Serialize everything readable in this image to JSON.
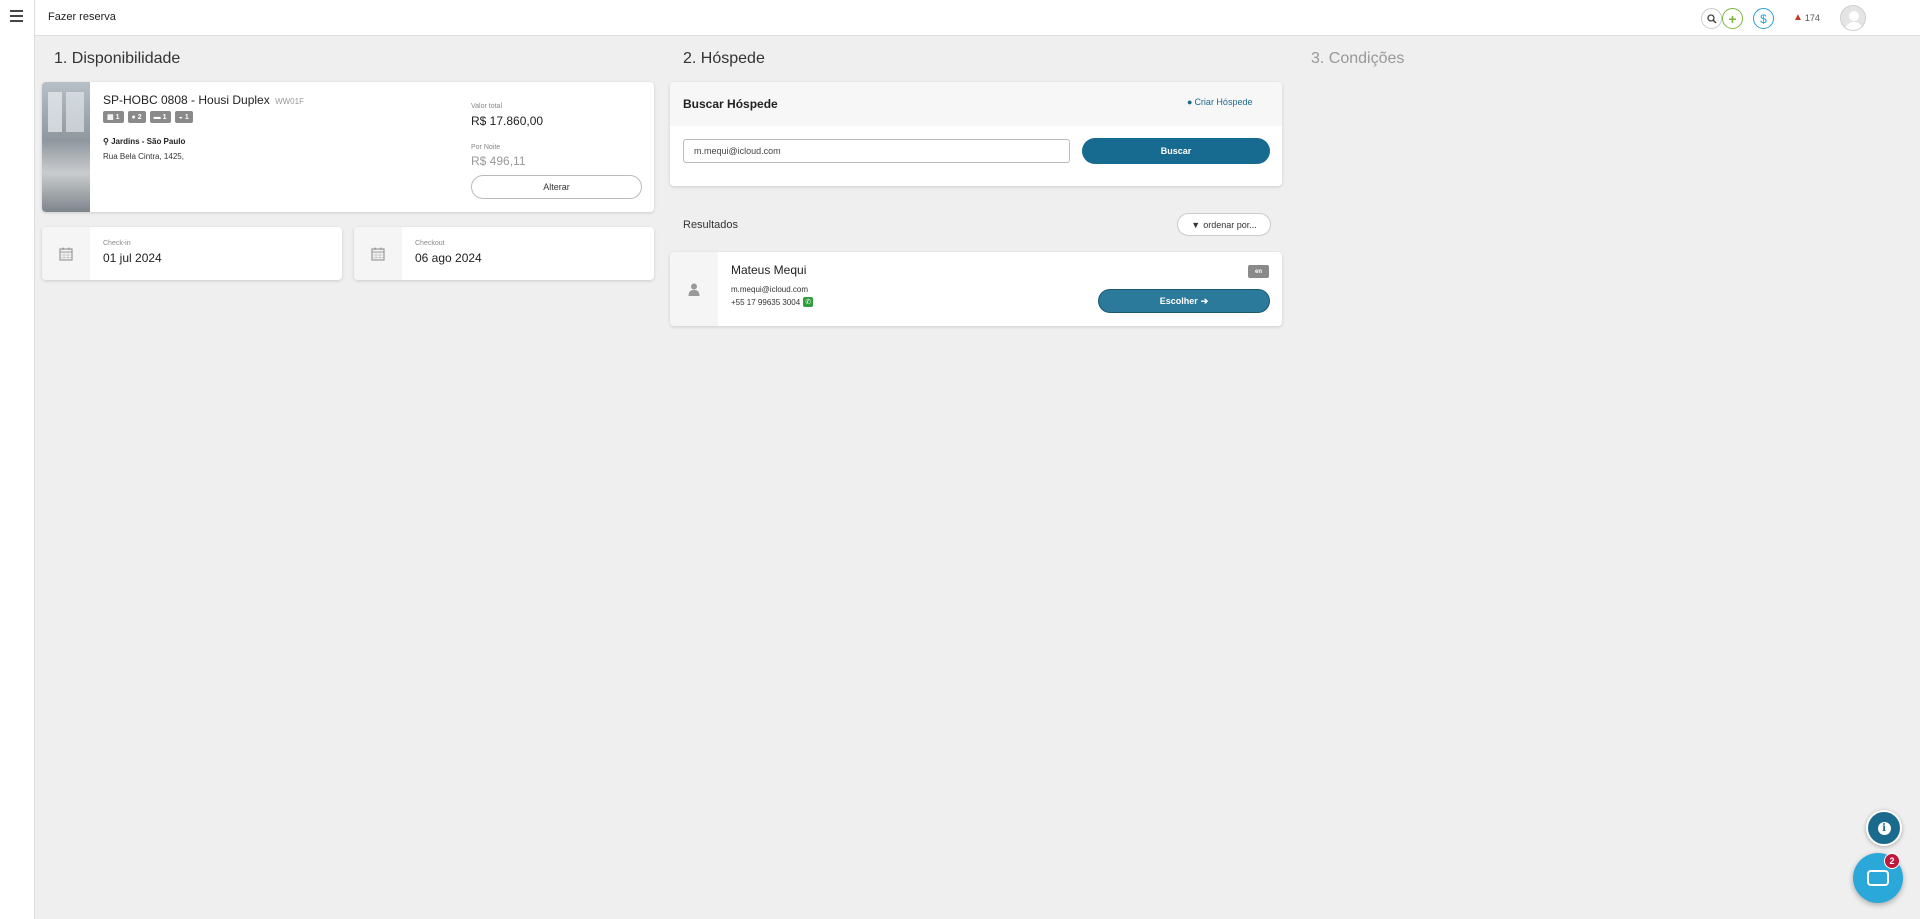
{
  "topbar": {
    "title": "Fazer reserva",
    "alerts_count": "174"
  },
  "sections": {
    "availability": "1. Disponibilidade",
    "guest": "2. Hóspede",
    "conditions": "3. Condições"
  },
  "property": {
    "name": "SP-HOBC 0808 - Housi Duplex",
    "code": "WW01F",
    "badges": [
      {
        "icon": "cube-icon",
        "value": "1"
      },
      {
        "icon": "user-icon",
        "value": "2"
      },
      {
        "icon": "bed-icon",
        "value": "1"
      },
      {
        "icon": "bath-icon",
        "value": "1"
      }
    ],
    "location": "Jardins - São Paulo",
    "address": "Rua Bela Cintra, 1425,",
    "total_label": "Valor total",
    "total_value": "R$ 17.860,00",
    "night_label": "Por Noite",
    "night_value": "R$ 496,11",
    "change_button": "Alterar"
  },
  "dates": {
    "checkin_label": "Check-in",
    "checkin_value": "01 jul 2024",
    "checkout_label": "Checkout",
    "checkout_value": "06 ago 2024"
  },
  "search": {
    "title": "Buscar Hóspede",
    "create_link": "Criar Hóspede",
    "input_value": "m.mequi@icloud.com",
    "search_button": "Buscar"
  },
  "results": {
    "label": "Resultados",
    "sort_button": "ordenar por...",
    "items": [
      {
        "name": "Mateus Mequi",
        "email": "m.mequi@icloud.com",
        "phone": "+55 17 99635 3004",
        "lang": "en",
        "choose_button": "Escolher"
      }
    ]
  },
  "chat": {
    "unread": "2"
  },
  "colors": {
    "primary": "#176b91",
    "add_accent": "#7cb342",
    "money_accent": "#29a0d8",
    "alert": "#c0392b",
    "chat": "#2ba8da",
    "chat_badge": "#c0173a"
  }
}
